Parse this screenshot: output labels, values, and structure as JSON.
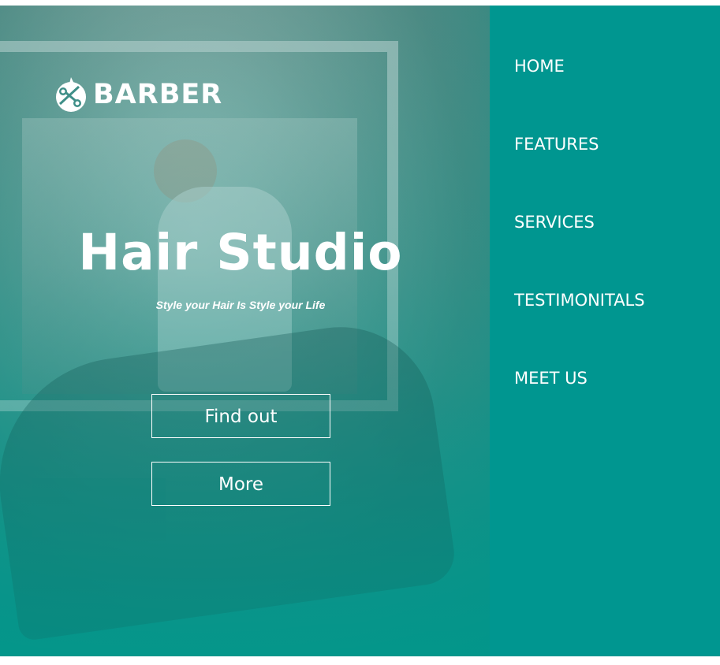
{
  "brand": {
    "name": "BARBER",
    "logo_icon": "scissors-comb-icon"
  },
  "hero": {
    "title": "Hair Studio",
    "subtitle": "Style your Hair Is Style your Life",
    "buttons": {
      "find_out": "Find out",
      "more": "More"
    }
  },
  "nav": {
    "items": [
      {
        "label": "HOME"
      },
      {
        "label": "FEATURES"
      },
      {
        "label": "SERVICES"
      },
      {
        "label": "TESTIMONITALS"
      },
      {
        "label": "MEET US"
      }
    ]
  },
  "colors": {
    "accent": "#009690",
    "text": "#ffffff"
  }
}
